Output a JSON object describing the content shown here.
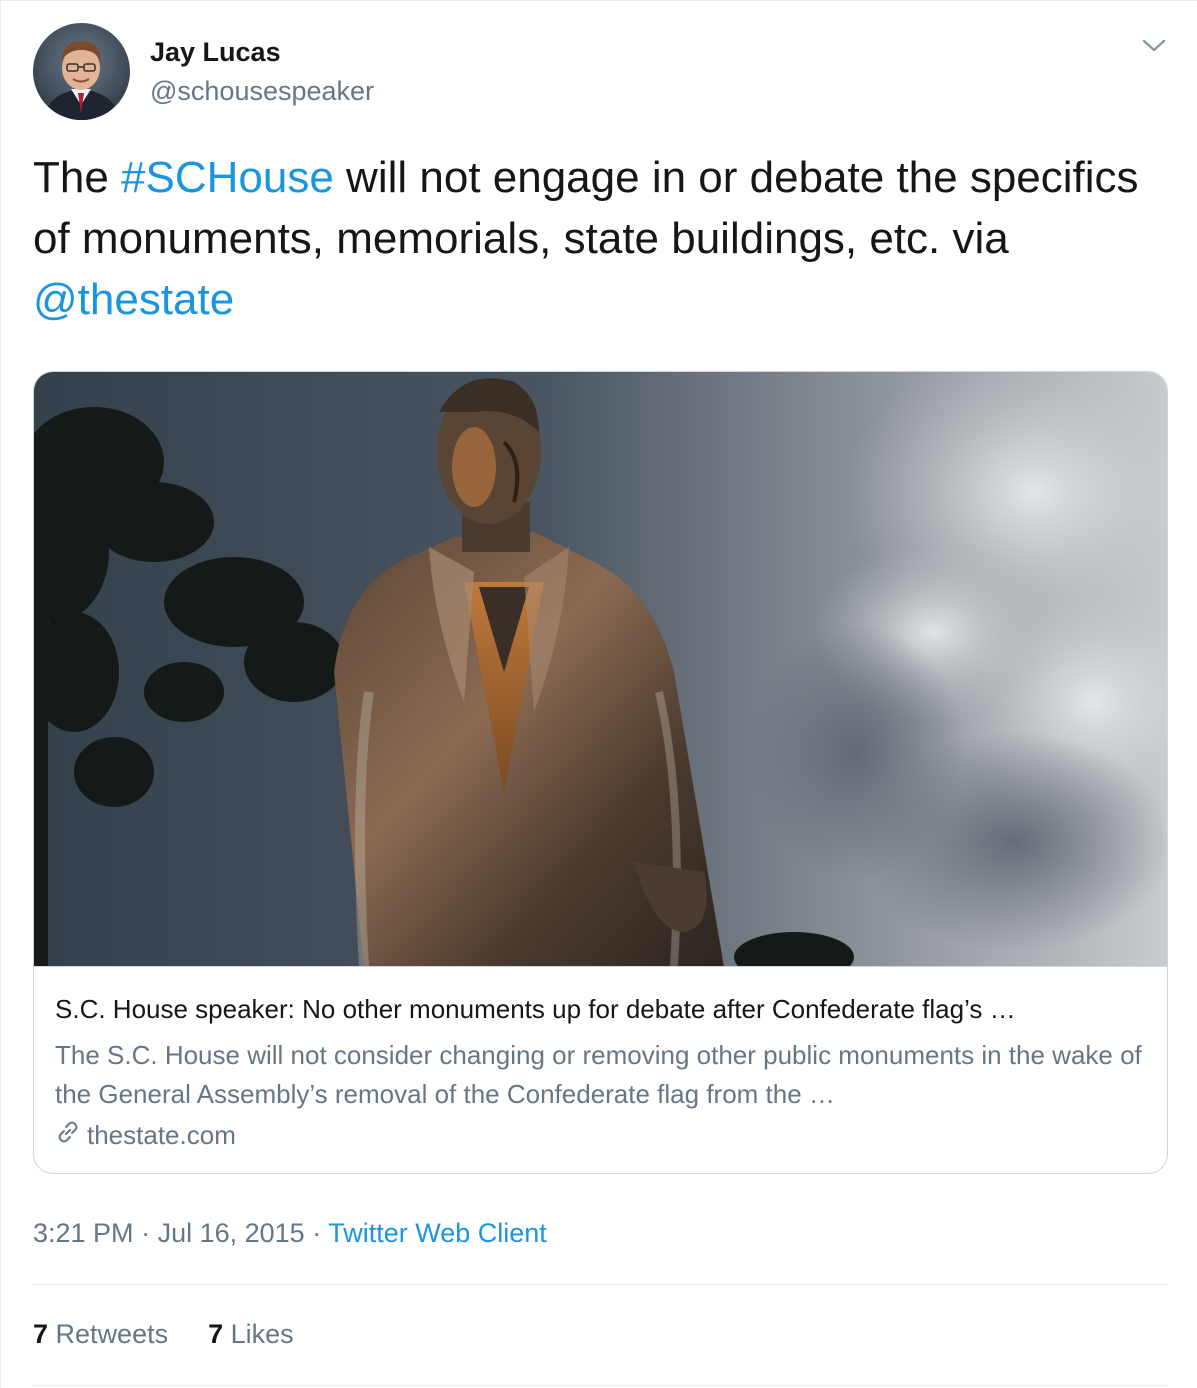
{
  "author": {
    "name": "Jay Lucas",
    "handle": "@schousespeaker"
  },
  "tweet": {
    "text_before_hashtag": "The ",
    "hashtag": "#SCHouse",
    "text_middle": " will not engage in or debate the specifics of monuments, memorials, state buildings, etc. via ",
    "mention": "@thestate"
  },
  "card": {
    "title": "S.C. House speaker: No other monuments up for debate after Confederate flag’s …",
    "description": "The S.C. House will not consider changing or removing other public monuments in the wake of the General Assembly’s removal of the Confederate flag from the …",
    "domain": "thestate.com"
  },
  "meta": {
    "time": "3:21 PM",
    "separator": " · ",
    "date": "Jul 16, 2015",
    "source": "Twitter Web Client"
  },
  "stats": {
    "retweets_count": "7",
    "retweets_label": "Retweets",
    "likes_count": "7",
    "likes_label": "Likes"
  },
  "colors": {
    "link": "#1b95e0",
    "secondary_text": "#657786",
    "border": "#ccd6dd"
  }
}
